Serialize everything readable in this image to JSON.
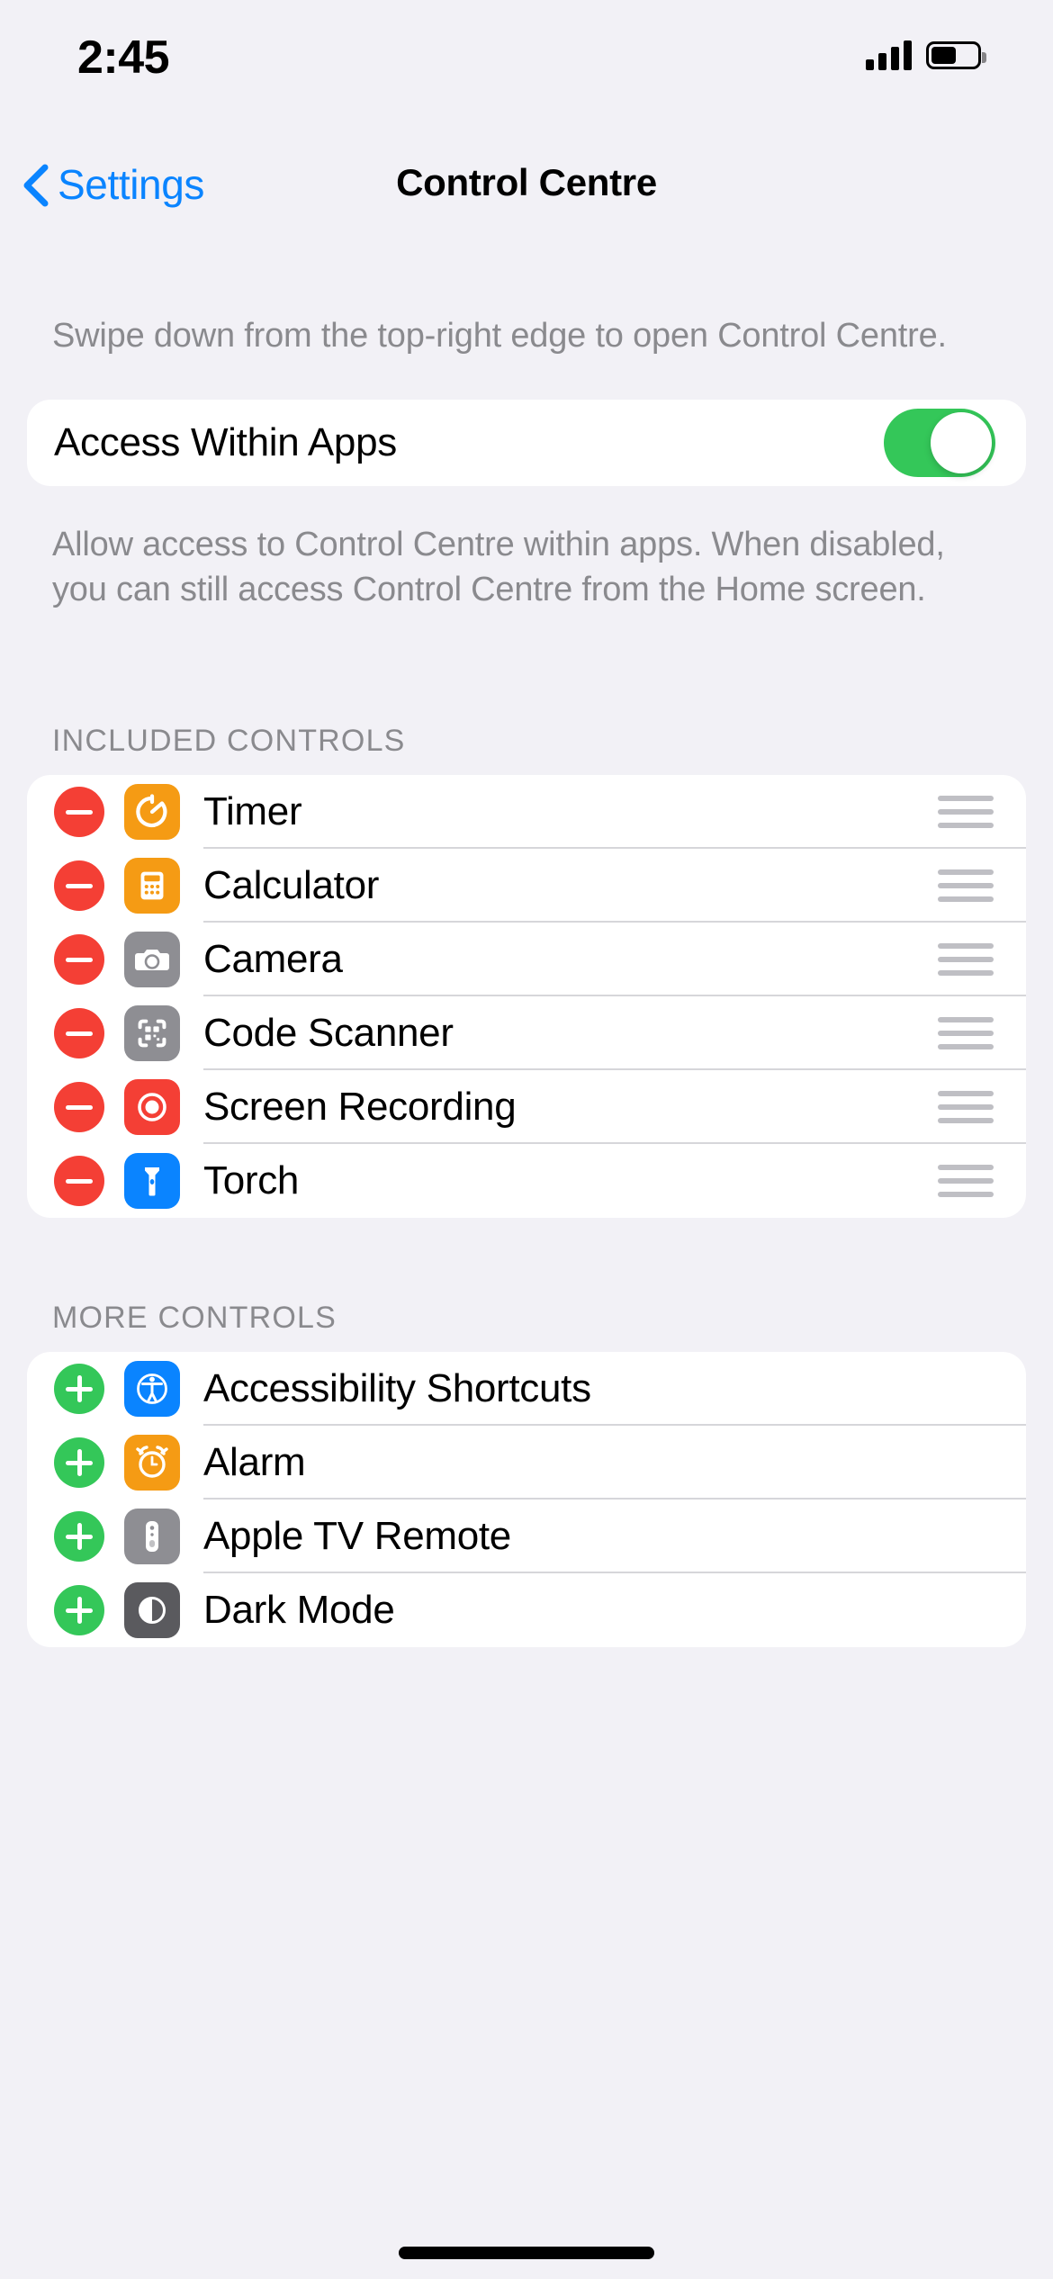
{
  "status_bar": {
    "time": "2:45",
    "signal_icon": "cellular-signal-icon",
    "battery_icon": "battery-icon"
  },
  "nav": {
    "back_label": "Settings",
    "back_icon": "chevron-left-icon",
    "title": "Control Centre"
  },
  "intro_note": "Swipe down from the top-right edge to open Control Centre.",
  "access_row": {
    "label": "Access Within Apps",
    "toggle_state": "on",
    "toggle_on_color": "#34C759"
  },
  "access_footer": "Allow access to Control Centre within apps. When disabled, you can still access Control Centre from the Home screen.",
  "included": {
    "header": "INCLUDED CONTROLS",
    "action_icon": "minus-circle-icon",
    "action_color": "#F43F35",
    "drag_icon": "drag-handle-icon",
    "items": [
      {
        "label": "Timer",
        "icon": "timer-icon",
        "icon_bg": "#F59B14"
      },
      {
        "label": "Calculator",
        "icon": "calculator-icon",
        "icon_bg": "#F59B14"
      },
      {
        "label": "Camera",
        "icon": "camera-icon",
        "icon_bg": "#8E8E93"
      },
      {
        "label": "Code Scanner",
        "icon": "qr-code-scanner-icon",
        "icon_bg": "#8E8E93"
      },
      {
        "label": "Screen Recording",
        "icon": "record-circle-icon",
        "icon_bg": "#F43F35"
      },
      {
        "label": "Torch",
        "icon": "flashlight-icon",
        "icon_bg": "#0A84FF"
      }
    ]
  },
  "more": {
    "header": "MORE CONTROLS",
    "action_icon": "plus-circle-icon",
    "action_color": "#34C759",
    "items": [
      {
        "label": "Accessibility Shortcuts",
        "icon": "accessibility-icon",
        "icon_bg": "#0A84FF"
      },
      {
        "label": "Alarm",
        "icon": "alarm-clock-icon",
        "icon_bg": "#F59B14"
      },
      {
        "label": "Apple TV Remote",
        "icon": "tv-remote-icon",
        "icon_bg": "#8E8E93"
      },
      {
        "label": "Dark Mode",
        "icon": "dark-mode-icon",
        "icon_bg": "#5A5A5E"
      }
    ]
  },
  "home_indicator": "home-indicator"
}
